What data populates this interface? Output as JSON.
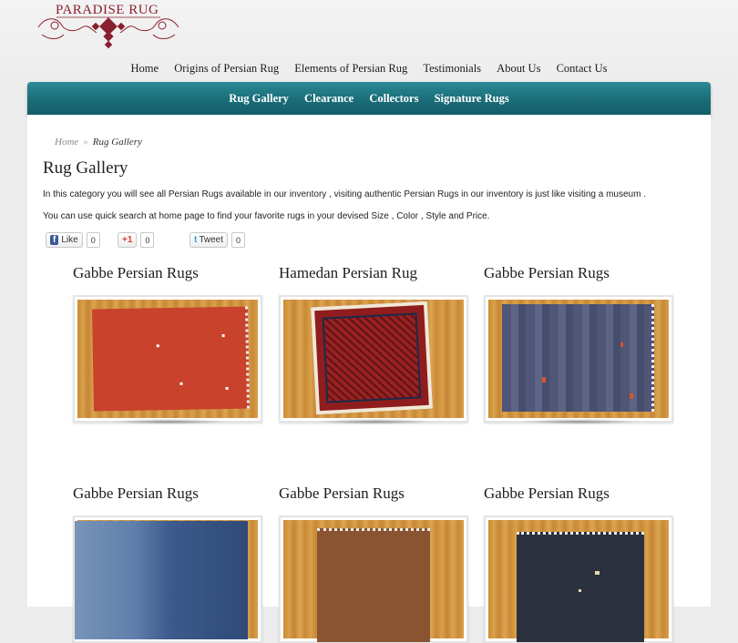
{
  "logo": {
    "text": "PARADISE RUG"
  },
  "top_nav": [
    {
      "label": "Home"
    },
    {
      "label": "Origins of Persian Rug"
    },
    {
      "label": "Elements of Persian Rug"
    },
    {
      "label": "Testimonials"
    },
    {
      "label": "About Us"
    },
    {
      "label": "Contact Us"
    }
  ],
  "sub_nav": [
    {
      "label": "Rug Gallery"
    },
    {
      "label": "Clearance"
    },
    {
      "label": "Collectors"
    },
    {
      "label": "Signature Rugs"
    }
  ],
  "breadcrumb": {
    "home": "Home",
    "separator": "»",
    "current": "Rug Gallery"
  },
  "page": {
    "title": "Rug Gallery",
    "intro_1": "In this category you will see all Persian Rugs available in our inventory , visiting authentic Persian Rugs in our inventory is just like visiting a museum .",
    "intro_2": "You can use quick search at home page to find your favorite rugs in your devised Size , Color , Style and Price."
  },
  "social": {
    "facebook": {
      "icon": "f",
      "label": "Like",
      "count": "0"
    },
    "google": {
      "label": "+1",
      "count": "0"
    },
    "twitter": {
      "icon": "t",
      "label": "Tweet",
      "count": "0"
    }
  },
  "products": [
    {
      "title": "Gabbe Persian Rugs",
      "rug_color": "#c8422c"
    },
    {
      "title": "Hamedan Persian Rug",
      "rug_color": "#8f1d1d"
    },
    {
      "title": "Gabbe Persian Rugs",
      "rug_color": "#4f5677"
    },
    {
      "title": "Gabbe Persian Rugs",
      "rug_color": "#3d5a8c"
    },
    {
      "title": "Gabbe Persian Rugs",
      "rug_color": "#8a5432"
    },
    {
      "title": "Gabbe Persian Rugs",
      "rug_color": "#2c313f"
    }
  ],
  "colors": {
    "teal": "#1a6d78",
    "logo": "#8a1f2d"
  }
}
